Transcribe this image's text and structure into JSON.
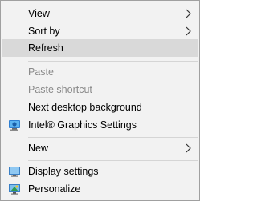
{
  "menu": {
    "items": [
      {
        "label": "View",
        "has_submenu": true,
        "enabled": true
      },
      {
        "label": "Sort by",
        "has_submenu": true,
        "enabled": true
      },
      {
        "label": "Refresh",
        "has_submenu": false,
        "enabled": true,
        "highlighted": true
      },
      {
        "label": "Paste",
        "has_submenu": false,
        "enabled": false
      },
      {
        "label": "Paste shortcut",
        "has_submenu": false,
        "enabled": false
      },
      {
        "label": "Next desktop background",
        "has_submenu": false,
        "enabled": true
      },
      {
        "label": "Intel® Graphics Settings",
        "has_submenu": false,
        "enabled": true,
        "icon": "intel-graphics-icon"
      },
      {
        "label": "New",
        "has_submenu": true,
        "enabled": true
      },
      {
        "label": "Display settings",
        "has_submenu": false,
        "enabled": true,
        "icon": "display-settings-icon"
      },
      {
        "label": "Personalize",
        "has_submenu": false,
        "enabled": true,
        "icon": "personalize-icon"
      }
    ]
  },
  "colors": {
    "menu_background": "#f2f2f2",
    "highlight": "#d9d9d9",
    "disabled_text": "#8a8a8a",
    "border": "#a0a0a0"
  }
}
